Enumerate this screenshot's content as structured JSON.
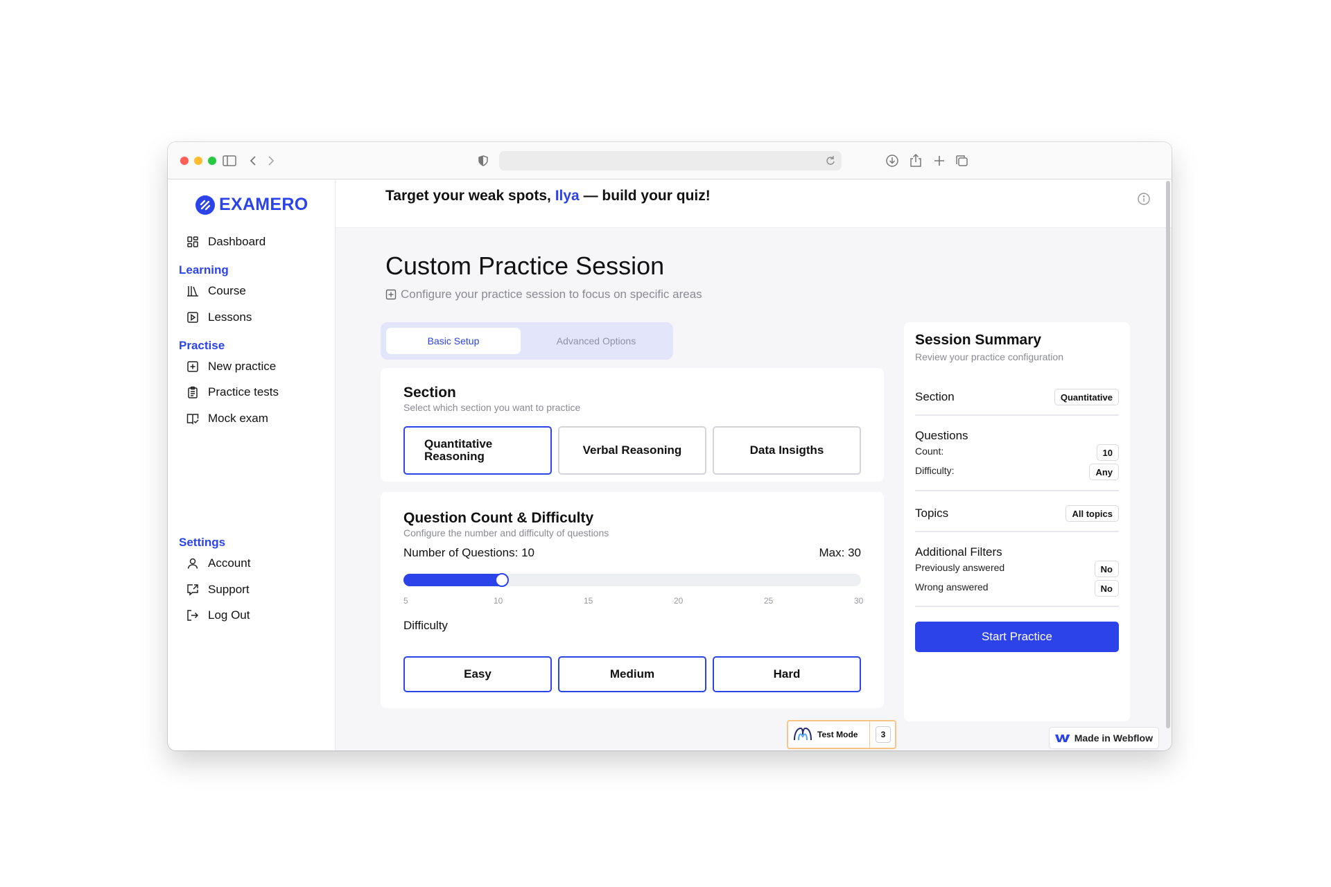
{
  "browser": {
    "url": ""
  },
  "brand": {
    "name": "EXAMERO",
    "accent": "#2b43e8"
  },
  "sidebar": {
    "dashboard": "Dashboard",
    "learning_header": "Learning",
    "course": "Course",
    "lessons": "Lessons",
    "practise_header": "Practise",
    "new_practice": "New practice",
    "practice_tests": "Practice tests",
    "mock_exam": "Mock exam",
    "settings_header": "Settings",
    "account": "Account",
    "support": "Support",
    "logout": "Log Out"
  },
  "header": {
    "greeting_prefix": "Target your weak spots,",
    "user_name": "Ilya",
    "greeting_suffix": "— build your quiz!"
  },
  "page": {
    "title": "Custom Practice Session",
    "subtitle": "Configure your practice session to focus on specific areas"
  },
  "tabs": {
    "basic": "Basic Setup",
    "advanced": "Advanced Options"
  },
  "section_card": {
    "title": "Section",
    "subtitle": "Select which section you want to practice",
    "options": [
      "Quantitative Reasoning",
      "Verbal Reasoning",
      "Data Insigths"
    ],
    "selected": "Quantitative Reasoning"
  },
  "count_card": {
    "title": "Question Count & Difficulty",
    "subtitle": "Configure the number and difficulty of questions",
    "count_label": "Number of Questions: 10",
    "max_label": "Max: 30",
    "slider_value": 10,
    "slider_min": 5,
    "slider_max": 30,
    "ticks": [
      "5",
      "10",
      "15",
      "20",
      "25",
      "30"
    ],
    "difficulty_label": "Difficulty",
    "difficulty_options": [
      "Easy",
      "Medium",
      "Hard"
    ]
  },
  "summary": {
    "title": "Session Summary",
    "subtitle": "Review your practice configuration",
    "section_label": "Section",
    "section_value": "Quantitative",
    "questions_label": "Questions",
    "count_label": "Count:",
    "count_value": "10",
    "difficulty_label": "Difficulty:",
    "difficulty_value": "Any",
    "topics_label": "Topics",
    "topics_value": "All topics",
    "filters_label": "Additional Filters",
    "prev_answered_label": "Previously answered",
    "prev_answered_value": "No",
    "wrong_answered_label": "Wrong answered",
    "wrong_answered_value": "No",
    "start_button": "Start Practice"
  },
  "test_mode": {
    "label": "Test Mode",
    "count": "3"
  },
  "webflow_badge": "Made in Webflow"
}
